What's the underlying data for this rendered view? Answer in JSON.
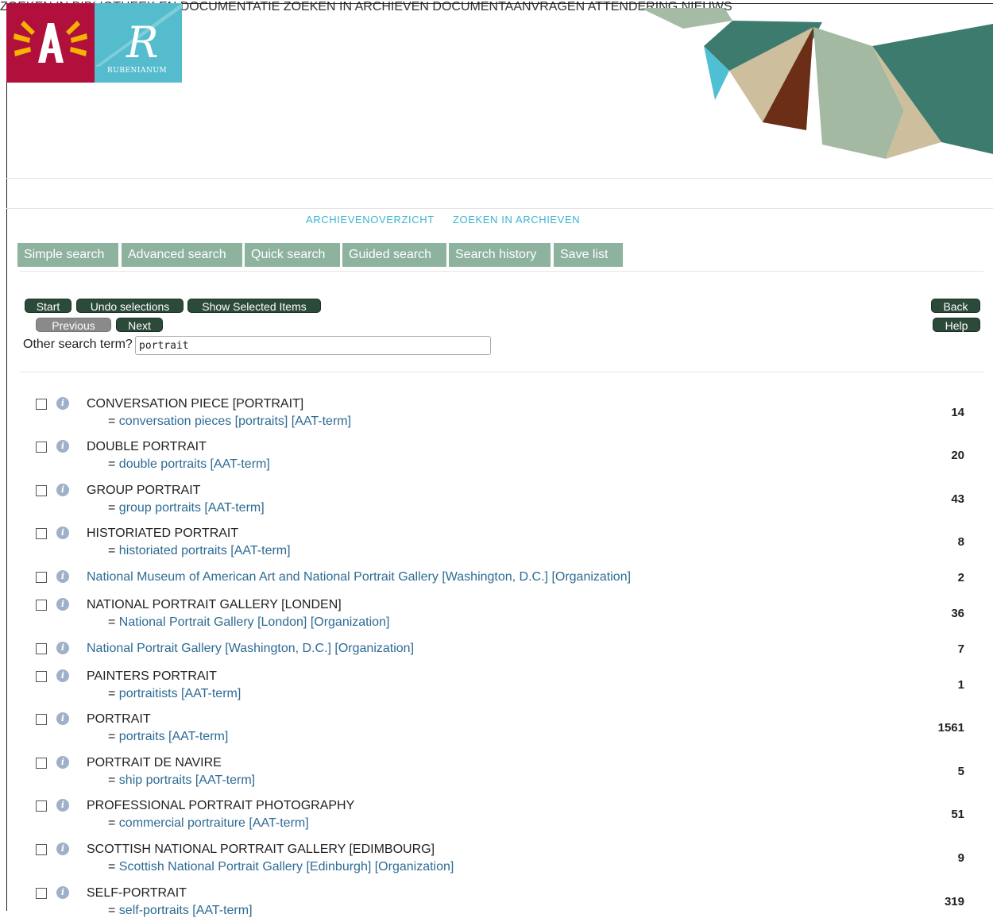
{
  "header": {
    "rubenianum_text": "RUBENIANUM"
  },
  "colors": {
    "accent": "#3bb4cf",
    "tab_bg": "#8db29d",
    "button_dark": "#2c4a39",
    "link": "#2d6b94"
  },
  "topnav": [
    "ZOEKEN IN BIBLIOTHEEK EN DOCUMENTATIE",
    "ZOEKEN IN ARCHIEVEN",
    "DOCUMENTAANVRAGEN",
    "ATTENDERING",
    "NIEUWS"
  ],
  "subnav": [
    "ARCHIEVENOVERZICHT",
    "ZOEKEN IN ARCHIEVEN"
  ],
  "tabs": [
    "Simple search",
    "Advanced search",
    "Quick search",
    "Guided search",
    "Search history",
    "Save list"
  ],
  "toolbar": {
    "start": "Start",
    "undo": "Undo selections",
    "show_selected": "Show Selected Items",
    "previous": "Previous",
    "next": "Next",
    "back": "Back",
    "help": "Help"
  },
  "search": {
    "label": "Other search term?",
    "value": "portrait"
  },
  "results": [
    {
      "term": "CONVERSATION PIECE [PORTRAIT]",
      "synonym": "conversation pieces [portraits] [AAT-term]",
      "count": "14"
    },
    {
      "term": "DOUBLE PORTRAIT",
      "synonym": "double portraits [AAT-term]",
      "count": "20"
    },
    {
      "term": "GROUP PORTRAIT",
      "synonym": "group portraits [AAT-term]",
      "count": "43"
    },
    {
      "term": "HISTORIATED PORTRAIT",
      "synonym": "historiated portraits [AAT-term]",
      "count": "8"
    },
    {
      "term": "National Museum of American Art and National Portrait Gallery [Washington, D.C.] [Organization]",
      "synonym": "",
      "count": "2"
    },
    {
      "term": "NATIONAL PORTRAIT GALLERY [LONDEN]",
      "synonym": "National Portrait Gallery [London] [Organization]",
      "count": "36"
    },
    {
      "term": "National Portrait Gallery [Washington, D.C.] [Organization]",
      "synonym": "",
      "count": "7"
    },
    {
      "term": "PAINTERS PORTRAIT",
      "synonym": "portraitists [AAT-term]",
      "count": "1"
    },
    {
      "term": "PORTRAIT",
      "synonym": "portraits [AAT-term]",
      "count": "1561"
    },
    {
      "term": "PORTRAIT DE NAVIRE",
      "synonym": "ship portraits [AAT-term]",
      "count": "5"
    },
    {
      "term": "PROFESSIONAL PORTRAIT PHOTOGRAPHY",
      "synonym": "commercial portraiture [AAT-term]",
      "count": "51"
    },
    {
      "term": "SCOTTISH NATIONAL PORTRAIT GALLERY [EDIMBOURG]",
      "synonym": "Scottish National Portrait Gallery [Edinburgh] [Organization]",
      "count": "9"
    },
    {
      "term": "SELF-PORTRAIT",
      "synonym": "self-portraits [AAT-term]",
      "count": "319"
    }
  ]
}
